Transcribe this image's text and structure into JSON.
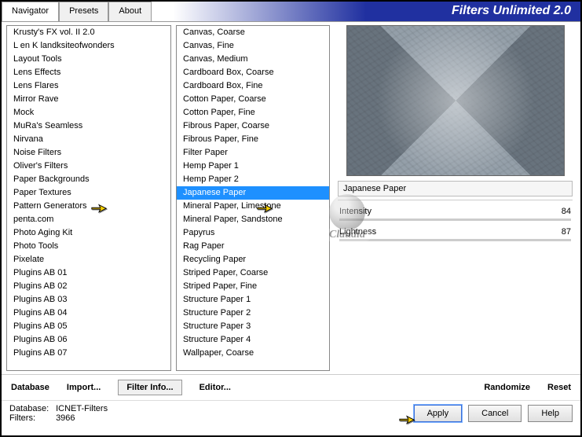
{
  "header": {
    "tabs": [
      "Navigator",
      "Presets",
      "About"
    ],
    "active_tab": 0,
    "title": "Filters Unlimited 2.0"
  },
  "categories": [
    "Krusty's FX vol. II 2.0",
    "L en K landksiteofwonders",
    "Layout Tools",
    "Lens Effects",
    "Lens Flares",
    "Mirror Rave",
    "Mock",
    "MuRa's Seamless",
    "Nirvana",
    "Noise Filters",
    "Oliver's Filters",
    "Paper Backgrounds",
    "Paper Textures",
    "Pattern Generators",
    "penta.com",
    "Photo Aging Kit",
    "Photo Tools",
    "Pixelate",
    "Plugins AB 01",
    "Plugins AB 02",
    "Plugins AB 03",
    "Plugins AB 04",
    "Plugins AB 05",
    "Plugins AB 06",
    "Plugins AB 07"
  ],
  "selected_category_index": 12,
  "filters": [
    "Canvas, Coarse",
    "Canvas, Fine",
    "Canvas, Medium",
    "Cardboard Box, Coarse",
    "Cardboard Box, Fine",
    "Cotton Paper, Coarse",
    "Cotton Paper, Fine",
    "Fibrous Paper, Coarse",
    "Fibrous Paper, Fine",
    "Filter Paper",
    "Hemp Paper 1",
    "Hemp Paper 2",
    "Japanese Paper",
    "Mineral Paper, Limestone",
    "Mineral Paper, Sandstone",
    "Papyrus",
    "Rag Paper",
    "Recycling Paper",
    "Striped Paper, Coarse",
    "Striped Paper, Fine",
    "Structure Paper 1",
    "Structure Paper 2",
    "Structure Paper 3",
    "Structure Paper 4",
    "Wallpaper, Coarse"
  ],
  "selected_filter_index": 12,
  "preview": {
    "filter_name": "Japanese Paper"
  },
  "params": [
    {
      "label": "Intensity",
      "value": 84
    },
    {
      "label": "Lightness",
      "value": 87
    }
  ],
  "toolbar": {
    "database": "Database",
    "import": "Import...",
    "filter_info": "Filter Info...",
    "editor": "Editor...",
    "randomize": "Randomize",
    "reset": "Reset"
  },
  "footer": {
    "db_label": "Database:",
    "db_value": "ICNET-Filters",
    "filters_label": "Filters:",
    "filters_value": "3966",
    "apply": "Apply",
    "cancel": "Cancel",
    "help": "Help"
  },
  "watermark": "Claudia"
}
